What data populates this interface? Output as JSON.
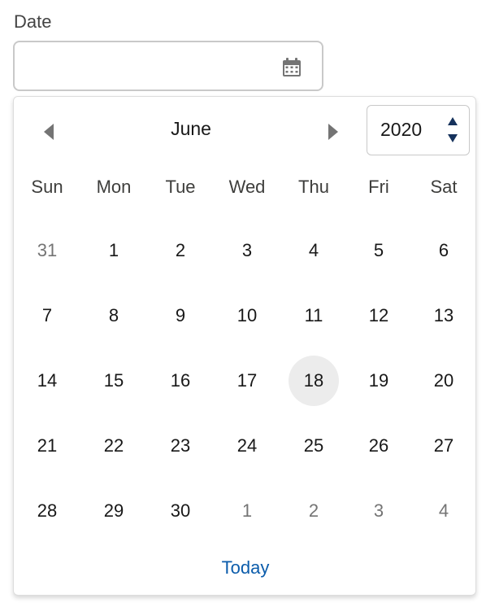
{
  "field": {
    "label": "Date",
    "value": "",
    "placeholder": ""
  },
  "picker": {
    "month": "June",
    "year": "2020",
    "today_label": "Today",
    "weekdays": [
      "Sun",
      "Mon",
      "Tue",
      "Wed",
      "Thu",
      "Fri",
      "Sat"
    ],
    "weeks": [
      [
        {
          "d": "31",
          "out": true
        },
        {
          "d": "1"
        },
        {
          "d": "2"
        },
        {
          "d": "3"
        },
        {
          "d": "4"
        },
        {
          "d": "5"
        },
        {
          "d": "6"
        }
      ],
      [
        {
          "d": "7"
        },
        {
          "d": "8"
        },
        {
          "d": "9"
        },
        {
          "d": "10"
        },
        {
          "d": "11"
        },
        {
          "d": "12"
        },
        {
          "d": "13"
        }
      ],
      [
        {
          "d": "14"
        },
        {
          "d": "15"
        },
        {
          "d": "16"
        },
        {
          "d": "17"
        },
        {
          "d": "18",
          "today": true
        },
        {
          "d": "19"
        },
        {
          "d": "20"
        }
      ],
      [
        {
          "d": "21"
        },
        {
          "d": "22"
        },
        {
          "d": "23"
        },
        {
          "d": "24"
        },
        {
          "d": "25"
        },
        {
          "d": "26"
        },
        {
          "d": "27"
        }
      ],
      [
        {
          "d": "28"
        },
        {
          "d": "29"
        },
        {
          "d": "30"
        },
        {
          "d": "1",
          "out": true
        },
        {
          "d": "2",
          "out": true
        },
        {
          "d": "3",
          "out": true
        },
        {
          "d": "4",
          "out": true
        }
      ]
    ]
  },
  "colors": {
    "accent": "#0b5cab",
    "today_highlight": "#ececec",
    "outside_month_text": "#747474",
    "icon": "#747474"
  },
  "icons": {
    "calendar": "calendar-icon",
    "prev": "chevron-left-icon",
    "next": "chevron-right-icon",
    "year_up": "caret-up-icon",
    "year_down": "caret-down-icon"
  }
}
